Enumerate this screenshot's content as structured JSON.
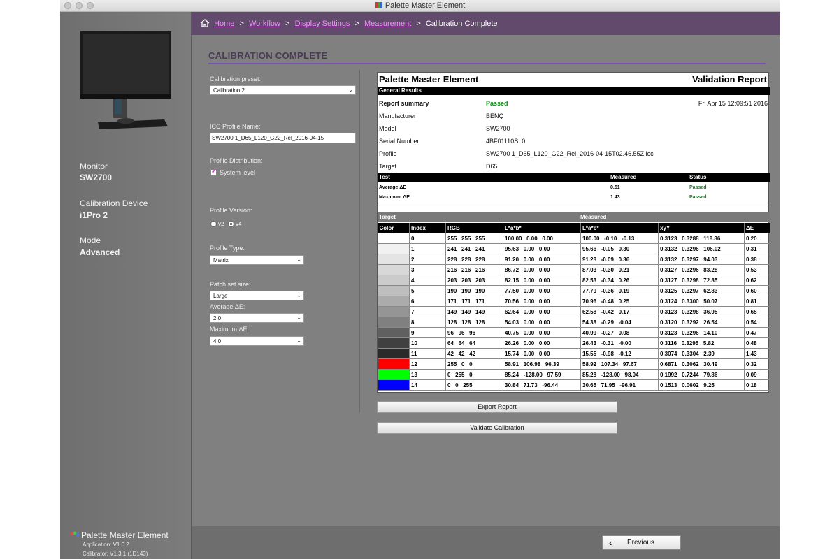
{
  "window": {
    "title": "Palette Master Element"
  },
  "breadcrumb": {
    "items": [
      {
        "label": "Home",
        "link": true
      },
      {
        "label": "Workflow",
        "link": true
      },
      {
        "label": "Display Settings",
        "link": true
      },
      {
        "label": "Measurement",
        "link": true
      },
      {
        "label": "Calibration Complete",
        "link": false
      }
    ],
    "separator": ">"
  },
  "sidebar": {
    "monitor_label": "Monitor",
    "monitor_value": "SW2700",
    "device_label": "Calibration Device",
    "device_value": "i1Pro 2",
    "mode_label": "Mode",
    "mode_value": "Advanced",
    "brand_name": "Palette Master Element",
    "app_version": "Application: V1.0.2",
    "calibrator_version": "Calibrator: V1.3.1 (1D143)"
  },
  "page": {
    "title": "CALIBRATION COMPLETE"
  },
  "settings": {
    "preset_label": "Calibration preset:",
    "preset_value": "Calibration 2",
    "icc_label": "ICC Profile Name:",
    "icc_value": "SW2700 1_D65_L120_G22_Rel_2016-04-15",
    "distribution_label": "Profile Distribution:",
    "system_level_label": "System level",
    "system_level_checked": true,
    "version_label": "Profile Version:",
    "v2_label": "v2",
    "v4_label": "v4",
    "version_selected": "v4",
    "type_label": "Profile Type:",
    "type_value": "Matrix",
    "patch_label": "Patch set size:",
    "patch_value": "Large",
    "avg_label": "Average ΔE:",
    "avg_value": "2.0",
    "max_label": "Maximum ΔE:",
    "max_value": "4.0"
  },
  "report": {
    "app_name": "Palette Master Element",
    "report_title": "Validation Report",
    "general_results": "General Results",
    "summary_label": "Report summary",
    "summary_value": "Passed",
    "date": "Fri Apr 15 12:09:51 2016",
    "manufacturer_label": "Manufacturer",
    "manufacturer_value": "BENQ",
    "model_label": "Model",
    "model_value": "SW2700",
    "serial_label": "Serial Number",
    "serial_value": "4BF01110SL0",
    "profile_label": "Profile",
    "profile_value": "SW2700 1_D65_L120_G22_Rel_2016-04-15T02.46.55Z.icc",
    "target_label": "Target",
    "target_value": "D65",
    "test_headers": {
      "test": "Test",
      "measured": "Measured",
      "status": "Status"
    },
    "tests": [
      {
        "name": "Average ΔE",
        "measured": "0.51",
        "status": "Passed"
      },
      {
        "name": "Maximum ΔE",
        "measured": "1.43",
        "status": "Passed"
      }
    ],
    "target_group": "Target",
    "measured_group": "Measured",
    "patch_headers": {
      "color": "Color",
      "index": "Index",
      "rgb": "RGB",
      "lab_target": "L*a*b*",
      "lab_measured": "L*a*b*",
      "xyy": "xyY",
      "de": "ΔE"
    },
    "patches": [
      {
        "swatch": "#ffffff",
        "index": "0",
        "rgb": "255   255   255",
        "lab_t": "100.00   0.00   0.00",
        "lab_m": "100.00   -0.10   -0.13",
        "xyy": "0.3123   0.3288   118.86",
        "de": "0.20"
      },
      {
        "swatch": "#f1f1f1",
        "index": "1",
        "rgb": "241   241   241",
        "lab_t": "95.63   0.00   0.00",
        "lab_m": "95.66   -0.05   0.30",
        "xyy": "0.3132   0.3296   106.02",
        "de": "0.31"
      },
      {
        "swatch": "#e4e4e4",
        "index": "2",
        "rgb": "228   228   228",
        "lab_t": "91.20   0.00   0.00",
        "lab_m": "91.28   -0.09   0.36",
        "xyy": "0.3132   0.3297   94.03",
        "de": "0.38"
      },
      {
        "swatch": "#d8d8d8",
        "index": "3",
        "rgb": "216   216   216",
        "lab_t": "86.72   0.00   0.00",
        "lab_m": "87.03   -0.30   0.21",
        "xyy": "0.3127   0.3296   83.28",
        "de": "0.53"
      },
      {
        "swatch": "#cbcbcb",
        "index": "4",
        "rgb": "203   203   203",
        "lab_t": "82.15   0.00   0.00",
        "lab_m": "82.53   -0.34   0.26",
        "xyy": "0.3127   0.3298   72.85",
        "de": "0.62"
      },
      {
        "swatch": "#bebebe",
        "index": "5",
        "rgb": "190   190   190",
        "lab_t": "77.50   0.00   0.00",
        "lab_m": "77.79   -0.36   0.19",
        "xyy": "0.3125   0.3297   62.83",
        "de": "0.60"
      },
      {
        "swatch": "#ababab",
        "index": "6",
        "rgb": "171   171   171",
        "lab_t": "70.56   0.00   0.00",
        "lab_m": "70.96   -0.48   0.25",
        "xyy": "0.3124   0.3300   50.07",
        "de": "0.81"
      },
      {
        "swatch": "#959595",
        "index": "7",
        "rgb": "149   149   149",
        "lab_t": "62.64   0.00   0.00",
        "lab_m": "62.58   -0.42   0.17",
        "xyy": "0.3123   0.3298   36.95",
        "de": "0.65"
      },
      {
        "swatch": "#808080",
        "index": "8",
        "rgb": "128   128   128",
        "lab_t": "54.03   0.00   0.00",
        "lab_m": "54.38   -0.29   -0.04",
        "xyy": "0.3120   0.3292   26.54",
        "de": "0.54"
      },
      {
        "swatch": "#606060",
        "index": "9",
        "rgb": "96   96   96",
        "lab_t": "40.75   0.00   0.00",
        "lab_m": "40.99   -0.27   0.08",
        "xyy": "0.3123   0.3296   14.10",
        "de": "0.47"
      },
      {
        "swatch": "#404040",
        "index": "10",
        "rgb": "64   64   64",
        "lab_t": "26.26   0.00   0.00",
        "lab_m": "26.43   -0.31   -0.00",
        "xyy": "0.3116   0.3295   5.82",
        "de": "0.48"
      },
      {
        "swatch": "#2a2a2a",
        "index": "11",
        "rgb": "42   42   42",
        "lab_t": "15.74   0.00   0.00",
        "lab_m": "15.55   -0.98   -0.12",
        "xyy": "0.3074   0.3304   2.39",
        "de": "1.43"
      },
      {
        "swatch": "#ff0000",
        "index": "12",
        "rgb": "255   0   0",
        "lab_t": "58.91   106.98   96.39",
        "lab_m": "58.92   107.34   97.67",
        "xyy": "0.6871   0.3062   30.49",
        "de": "0.32"
      },
      {
        "swatch": "#00ff00",
        "index": "13",
        "rgb": "0   255   0",
        "lab_t": "85.24   -128.00   97.59",
        "lab_m": "85.28   -128.00   98.04",
        "xyy": "0.1992   0.7244   79.86",
        "de": "0.09"
      },
      {
        "swatch": "#0000ff",
        "index": "14",
        "rgb": "0   0   255",
        "lab_t": "30.84   71.73   -96.44",
        "lab_m": "30.65   71.95   -96.91",
        "xyy": "0.1513   0.0602   9.25",
        "de": "0.18"
      }
    ]
  },
  "actions": {
    "export_label": "Export Report",
    "validate_label": "Validate Calibration",
    "previous_label": "Previous"
  },
  "colors": {
    "accent": "#7d4eb3",
    "breadcrumb_bg": "#614a6b",
    "link": "#f48fff",
    "passed": "#0f8a1a"
  },
  "icons": {
    "home": "home-icon",
    "back": "chevron-left-icon",
    "caret": "chevron-down-icon"
  }
}
